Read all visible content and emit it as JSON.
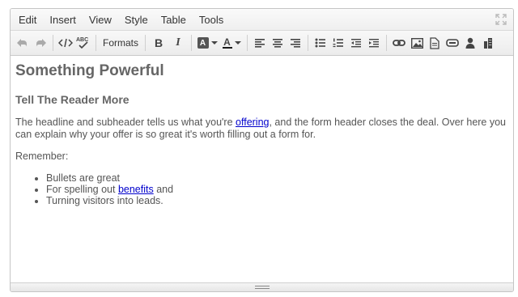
{
  "menubar": {
    "items": [
      "Edit",
      "Insert",
      "View",
      "Style",
      "Table",
      "Tools"
    ]
  },
  "toolbar": {
    "formats_label": "Formats",
    "icons": [
      "undo-icon",
      "redo-icon",
      "source-code-icon",
      "spellcheck-icon",
      "bold-icon",
      "italic-icon",
      "background-color-icon",
      "text-color-icon",
      "align-left-icon",
      "align-center-icon",
      "align-right-icon",
      "bullet-list-icon",
      "numbered-list-icon",
      "outdent-icon",
      "indent-icon",
      "link-icon",
      "image-icon",
      "document-icon",
      "media-icon",
      "user-icon",
      "table-icon",
      "fullscreen-icon"
    ],
    "spellcheck_text": "ABC",
    "bold_text": "B",
    "italic_text": "I",
    "bgcolor_text": "A",
    "textcolor_text": "A",
    "textcolor_swatch": "#1a1a1a"
  },
  "content": {
    "heading": "Something Powerful",
    "subheading": "Tell The Reader More",
    "para1_before": "The headline and subheader tells us what you're ",
    "para1_link": "offering",
    "para1_after": ", and the form header closes the deal. Over here you can explain why your offer is so great it's worth filling out a form for.",
    "para2": "Remember:",
    "bullets": {
      "b1": "Bullets are great",
      "b2_before": "For spelling out ",
      "b2_link": "benefits",
      "b2_after": " and",
      "b3": "Turning visitors into leads."
    }
  },
  "colors": {
    "link": "#0000cc",
    "text": "#555555"
  }
}
